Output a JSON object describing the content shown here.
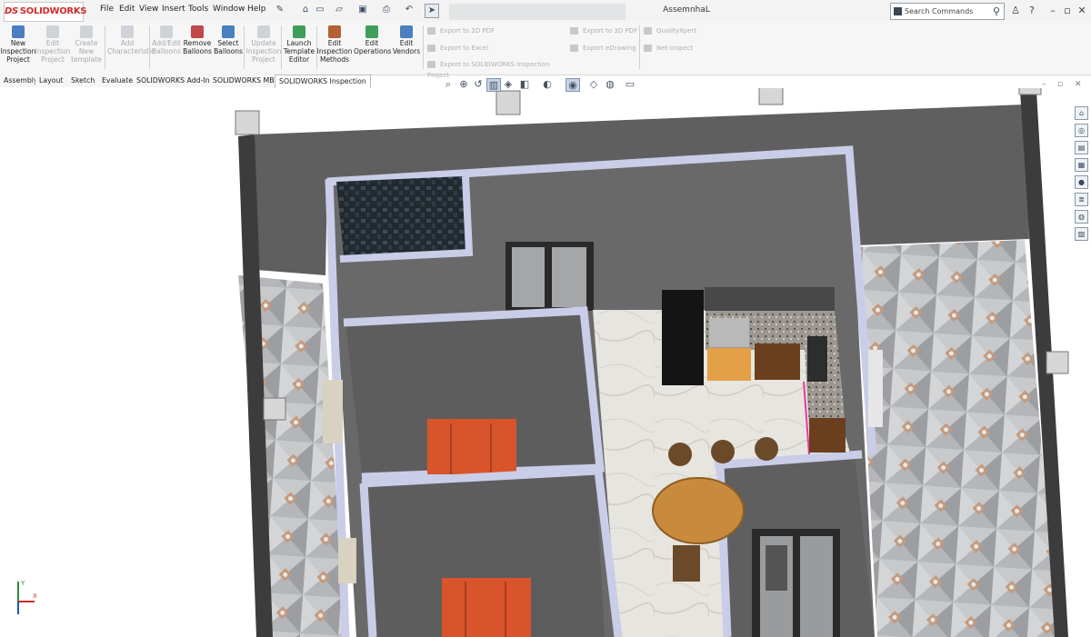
{
  "app": {
    "logo_text": "SOLIDWORKS",
    "logo_mark": "DS"
  },
  "menus": [
    "File",
    "Edit",
    "View",
    "Insert",
    "Tools",
    "Window",
    "Help"
  ],
  "document_title": "AssemnhaL",
  "search": {
    "placeholder": "Search Commands"
  },
  "title_icons": [
    "pin-icon",
    "home-icon",
    "new-file-icon",
    "open-icon",
    "save-icon",
    "print-icon",
    "undo-icon",
    "select-icon",
    "user-icon",
    "help-icon",
    "minimize-icon",
    "restore-icon",
    "close-icon"
  ],
  "commands": [
    {
      "label": "New Inspection Project",
      "enabled": true,
      "icon": "new-inspection-project-icon"
    },
    {
      "label": "Edit Inspection Project",
      "enabled": false,
      "icon": "edit-inspection-project-icon"
    },
    {
      "label": "Create New template",
      "enabled": false,
      "icon": "create-template-icon"
    },
    {
      "label": "Add Characteristic",
      "enabled": false,
      "icon": "add-characteristic-icon"
    },
    {
      "label": "Add/Edit Balloons",
      "enabled": false,
      "icon": "add-edit-balloons-icon"
    },
    {
      "label": "Remove Balloons",
      "enabled": true,
      "icon": "remove-balloons-icon"
    },
    {
      "label": "Select Balloons",
      "enabled": true,
      "icon": "select-balloons-icon"
    },
    {
      "label": "Update Inspection Project",
      "enabled": false,
      "icon": "update-project-icon"
    },
    {
      "label": "Launch Template Editor",
      "enabled": true,
      "icon": "launch-template-editor-icon"
    },
    {
      "label": "Edit Inspection Methods",
      "enabled": true,
      "icon": "edit-inspection-methods-icon"
    },
    {
      "label": "Edit Operations",
      "enabled": true,
      "icon": "edit-operations-icon"
    },
    {
      "label": "Edit Vendors",
      "enabled": true,
      "icon": "edit-vendors-icon"
    }
  ],
  "export_commands": {
    "col1": [
      "Export to 2D PDF",
      "Export to Excel",
      "Export to SOLIDWORKS Inspection Project"
    ],
    "col2": [
      "Export to 3D PDF",
      "Export eDrawing"
    ],
    "col3": [
      "QualityXpert",
      "Net-Inspect"
    ]
  },
  "tabs": [
    "Assembly",
    "Layout",
    "Sketch",
    "Evaluate",
    "SOLIDWORKS Add-Ins",
    "SOLIDWORKS MBD",
    "SOLIDWORKS Inspection"
  ],
  "active_tab": "SOLIDWORKS Inspection",
  "hud_icons": [
    "zoom-to-fit-icon",
    "zoom-area-icon",
    "previous-view-icon",
    "section-view-icon",
    "view-orientation-icon",
    "display-style-icon",
    "hide-show-icon",
    "edit-appearance-icon",
    "scene-icon",
    "view-settings-icon"
  ],
  "taskpane_icons": [
    "home-icon",
    "resources-icon",
    "design-library-icon",
    "file-explorer-icon",
    "appearances-icon",
    "custom-properties-icon",
    "forum-icon",
    "view-palette-icon"
  ],
  "triad": {
    "x_label": "X",
    "y_label": "Y"
  },
  "colors": {
    "accent": "#d12b2b",
    "wall": "#616161",
    "wall_top": "#c9cde8",
    "floor_tile": "#b6b8bb",
    "bed": "#d9542a",
    "wood": "#b7843b"
  }
}
